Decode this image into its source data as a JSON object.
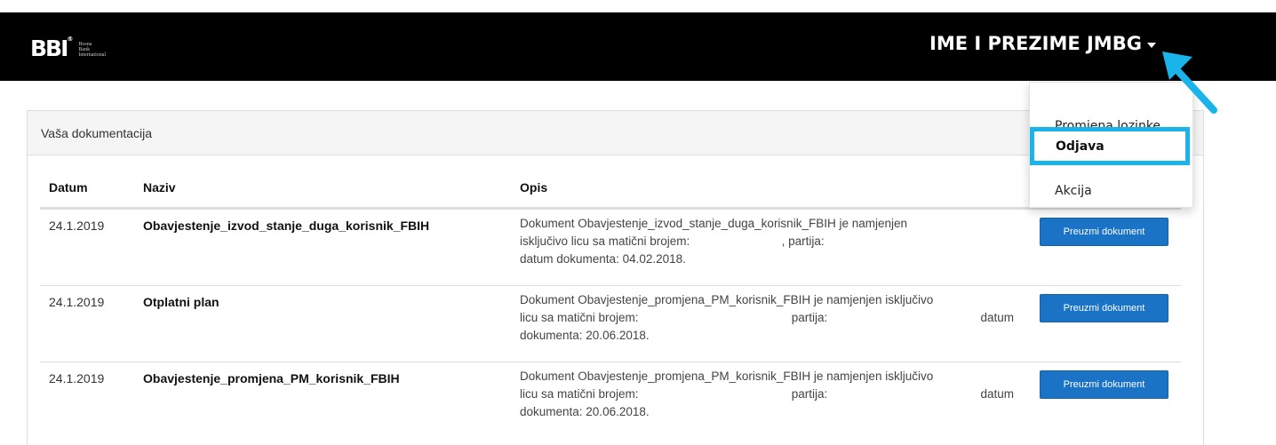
{
  "brand": {
    "logo_text": "BBI",
    "logo_sub": [
      "Bosna",
      "Bank",
      "International"
    ]
  },
  "header": {
    "user_label": "IME I PREZIME JMBG"
  },
  "user_dropdown": {
    "items": [
      "Promjena lozinke",
      "Odjava",
      "Akcija"
    ],
    "highlighted": "Odjava"
  },
  "panel": {
    "title": "Vaša dokumentacija"
  },
  "table": {
    "columns": [
      "Datum",
      "Naziv",
      "Opis"
    ],
    "rows": [
      {
        "date": "24.1.2019",
        "name": "Obavjestenje_izvod_stanje_duga_korisnik_FBIH",
        "desc_line1": "Dokument Obavjestenje_izvod_stanje_duga_korisnik_FBIH je namjenjen",
        "desc_line2_a": "isključivo licu sa matični brojem:",
        "desc_line2_b": ", partija:",
        "desc_line2_c": "",
        "desc_line3": "datum dokumenta: 04.02.2018.",
        "button": "Preuzmi dokument"
      },
      {
        "date": "24.1.2019",
        "name": "Otplatni plan",
        "desc_line1": "Dokument Obavjestenje_promjena_PM_korisnik_FBIH je namjenjen isključivo",
        "desc_line2_a": "licu sa matični brojem:",
        "desc_line2_b": "partija:",
        "desc_line2_c": "datum",
        "desc_line3": "dokumenta: 20.06.2018.",
        "button": "Preuzmi dokument"
      },
      {
        "date": "24.1.2019",
        "name": "Obavjestenje_promjena_PM_korisnik_FBIH",
        "desc_line1": "Dokument Obavjestenje_promjena_PM_korisnik_FBIH je namjenjen isključivo",
        "desc_line2_a": "licu sa matični brojem:",
        "desc_line2_b": "partija:",
        "desc_line2_c": "datum",
        "desc_line3": "dokumenta: 20.06.2018.",
        "button": "Preuzmi dokument"
      }
    ]
  },
  "colors": {
    "header_bg": "#000000",
    "button_bg": "#1a73c4",
    "highlight": "#1ab3ea"
  },
  "icons": {
    "user_menu_caret": "caret-down-icon",
    "callout": "arrow-pointer-icon"
  }
}
